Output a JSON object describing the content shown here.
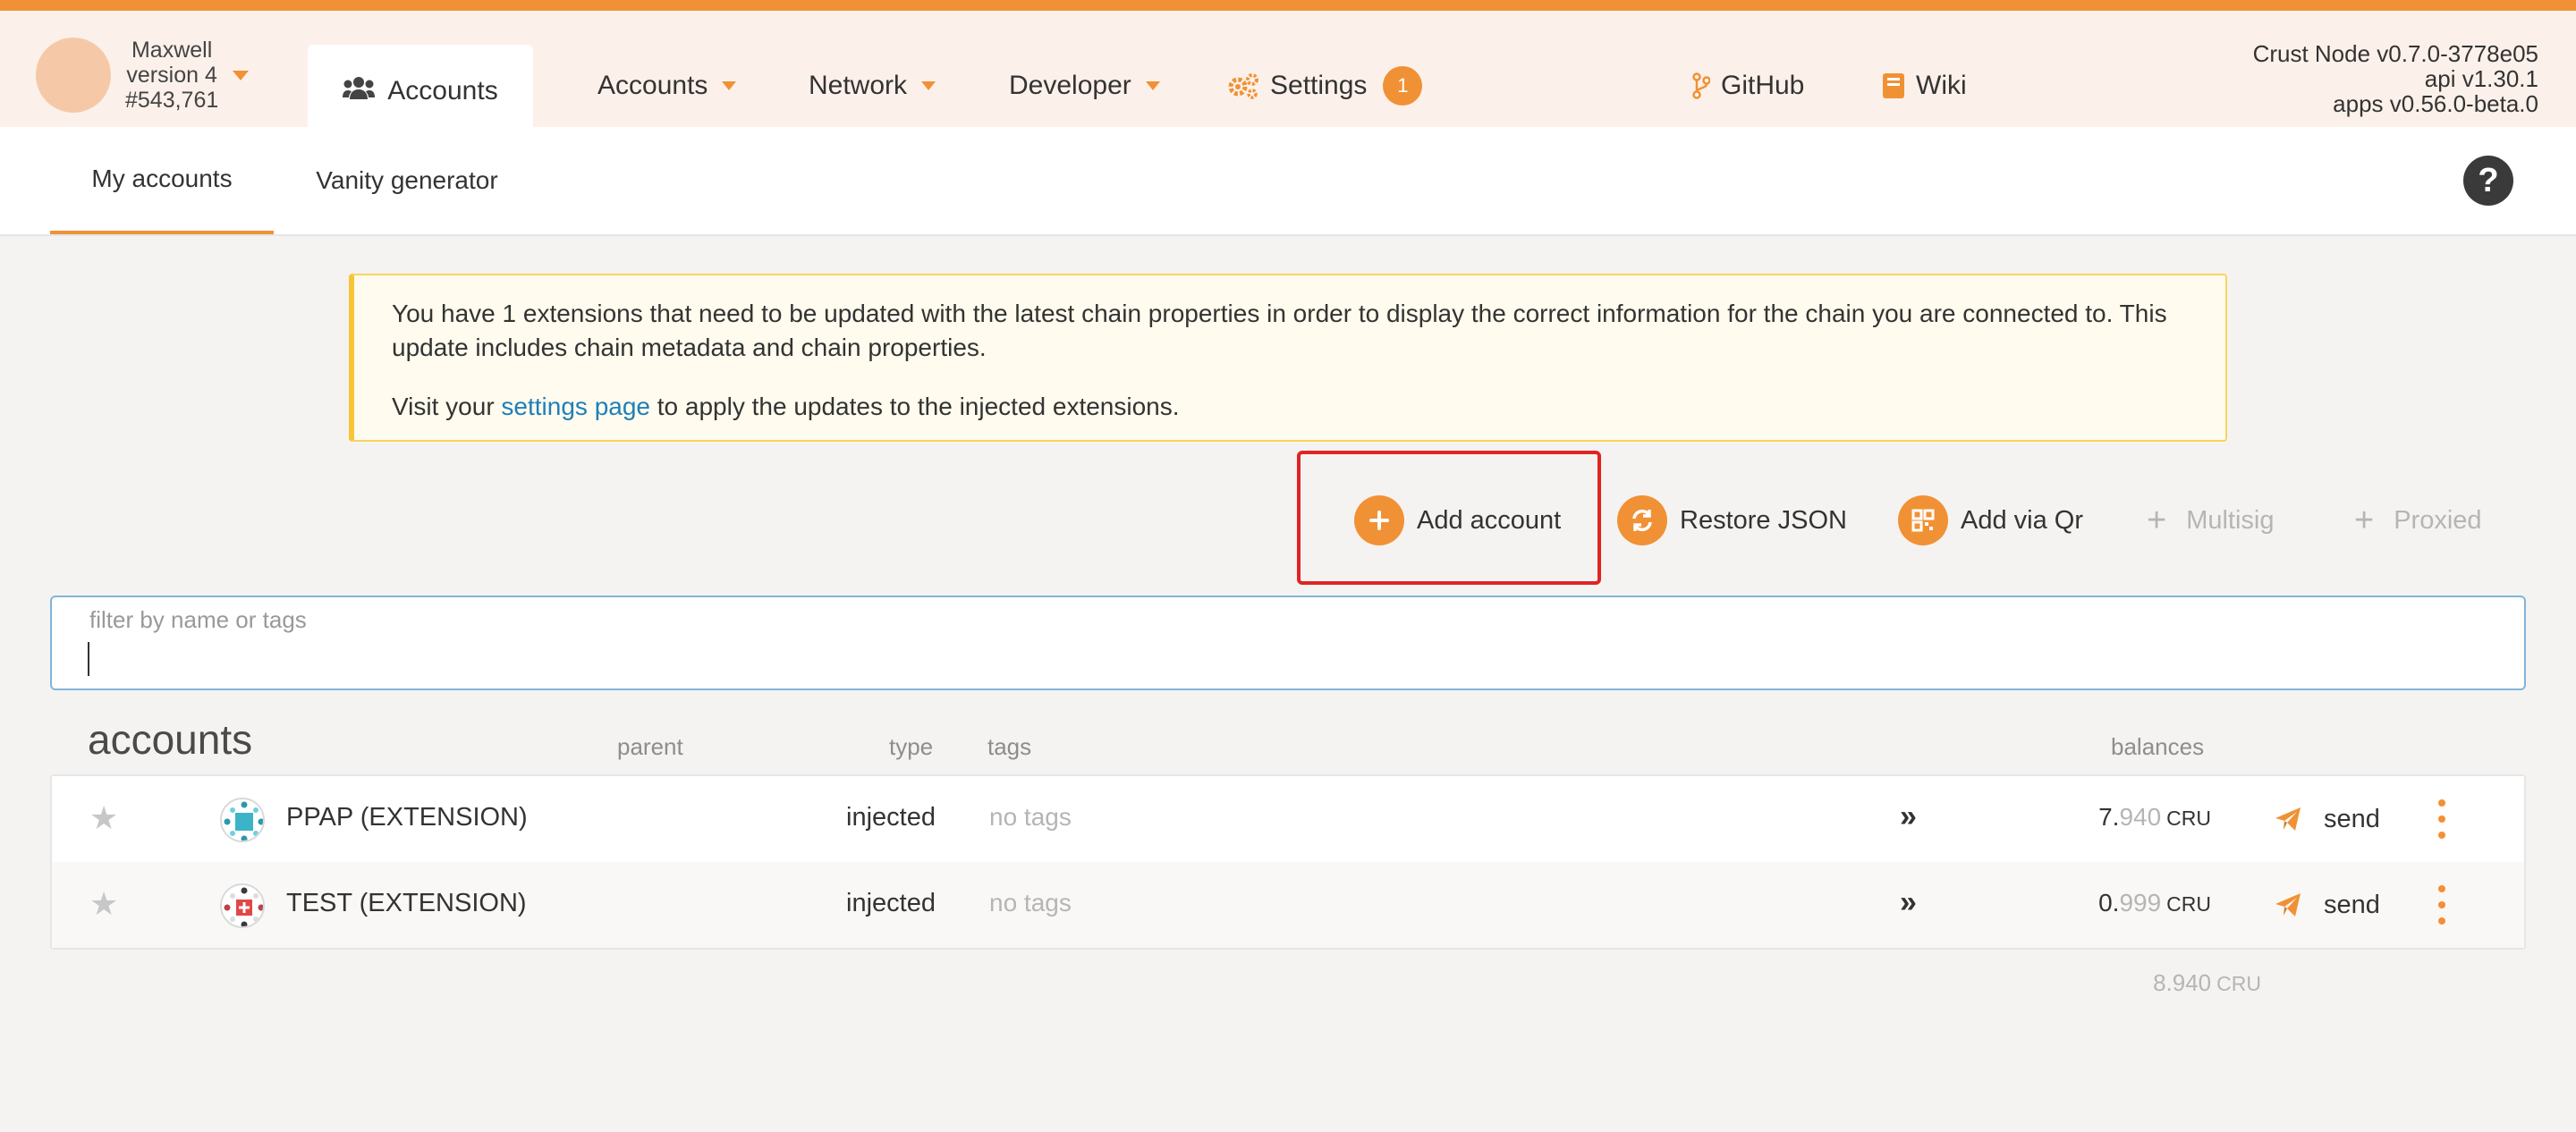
{
  "chain": {
    "name": "Maxwell",
    "version": "version 4",
    "block": "#543,761"
  },
  "nav": {
    "active_label": "Accounts",
    "items": [
      {
        "label": "Accounts",
        "has_caret": true
      },
      {
        "label": "Network",
        "has_caret": true
      },
      {
        "label": "Developer",
        "has_caret": true
      },
      {
        "label": "Settings",
        "badge": "1"
      },
      {
        "label": "GitHub"
      },
      {
        "label": "Wiki"
      }
    ]
  },
  "version_info": {
    "node": "Crust Node v0.7.0-3778e05",
    "api": "api v1.30.1",
    "apps": "apps v0.56.0-beta.0"
  },
  "tabs": [
    {
      "label": "My accounts",
      "active": true
    },
    {
      "label": "Vanity generator",
      "active": false
    }
  ],
  "help_label": "?",
  "warning": {
    "line1": "You have 1 extensions that need to be updated with the latest chain properties in order to display the correct information for the chain you are connected to. This update includes chain metadata and chain properties.",
    "visit_prefix": "Visit your ",
    "link": "settings page",
    "visit_suffix": " to apply the updates to the injected extensions."
  },
  "actions": {
    "add_account": "Add account",
    "restore_json": "Restore JSON",
    "add_via_qr": "Add via Qr",
    "multisig": "Multisig",
    "proxied": "Proxied"
  },
  "filter": {
    "label": "filter by name or tags",
    "value": ""
  },
  "table": {
    "title": "accounts",
    "headers": {
      "parent": "parent",
      "type": "type",
      "tags": "tags",
      "balances": "balances"
    },
    "rows": [
      {
        "name": "PPAP (EXTENSION)",
        "type": "injected",
        "tags": "no tags",
        "balance_int": "7.",
        "balance_dec": "940",
        "unit": "CRU",
        "send": "send",
        "expand": "»"
      },
      {
        "name": "TEST (EXTENSION)",
        "type": "injected",
        "tags": "no tags",
        "balance_int": "0.",
        "balance_dec": "999",
        "unit": "CRU",
        "send": "send",
        "expand": "»"
      }
    ],
    "total": "8.940",
    "total_unit": "CRU"
  },
  "colors": {
    "accent": "#f19135",
    "highlight": "#e02323",
    "link": "#1f7fb8"
  }
}
